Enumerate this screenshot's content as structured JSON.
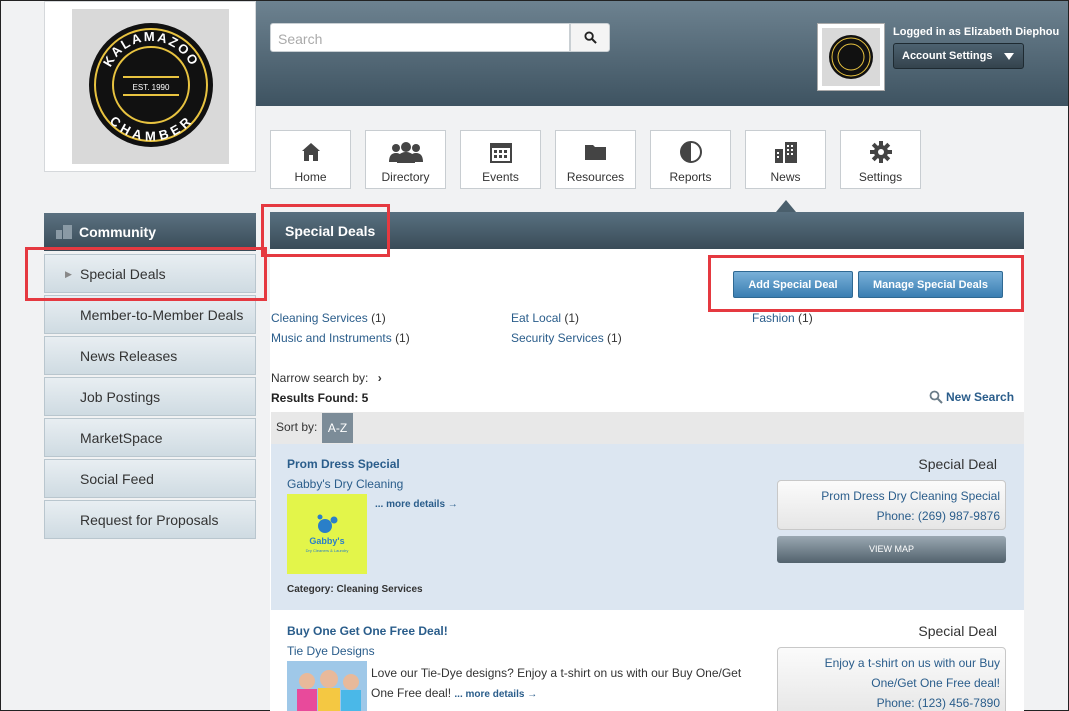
{
  "header": {
    "search_placeholder": "Search",
    "logged_in": "Logged in as Elizabeth Diephou",
    "account_settings": "Account Settings"
  },
  "nav": [
    {
      "label": "Home",
      "icon": "home-icon"
    },
    {
      "label": "Directory",
      "icon": "people-icon"
    },
    {
      "label": "Events",
      "icon": "calendar-icon"
    },
    {
      "label": "Resources",
      "icon": "folder-icon"
    },
    {
      "label": "Reports",
      "icon": "pie-chart-icon"
    },
    {
      "label": "News",
      "icon": "building-icon"
    },
    {
      "label": "Settings",
      "icon": "gear-icon"
    }
  ],
  "sidebar": {
    "title": "Community",
    "items": [
      {
        "label": "Special Deals"
      },
      {
        "label": "Member-to-Member Deals"
      },
      {
        "label": "News Releases"
      },
      {
        "label": "Job Postings"
      },
      {
        "label": "MarketSpace"
      },
      {
        "label": "Social Feed"
      },
      {
        "label": "Request for Proposals"
      }
    ]
  },
  "content": {
    "title": "Special Deals",
    "add_button": "Add Special Deal",
    "manage_button": "Manage Special Deals",
    "categories": [
      {
        "name": "Cleaning Services",
        "count": "(1)"
      },
      {
        "name": "Eat Local",
        "count": "(1)"
      },
      {
        "name": "Fashion",
        "count": "(1)"
      },
      {
        "name": "Music and Instruments",
        "count": "(1)"
      },
      {
        "name": "Security Services",
        "count": "(1)"
      }
    ],
    "narrow_label": "Narrow search by:",
    "results_label": "Results Found: 5",
    "new_search": "New Search",
    "sort_label": "Sort by:",
    "sort_az": "A-Z",
    "listings": [
      {
        "title": "Prom Dress Special",
        "business": "Gabby's Dry Cleaning",
        "type": "Special Deal",
        "more": "... more details →",
        "card_title": "Prom Dress Dry Cleaning Special",
        "phone": "Phone: (269) 987-9876",
        "view_map": "VIEW MAP",
        "category": "Category: Cleaning Services",
        "logo_name": "Gabby's",
        "logo_sub": "Dry Cleaners & Laundry"
      },
      {
        "title": "Buy One Get One Free Deal!",
        "business": "Tie Dye Designs",
        "type": "Special Deal",
        "desc": "Love our Tie-Dye designs? Enjoy a t-shirt on us with our Buy One/Get One Free deal!",
        "more": "... more details →",
        "card_title": "Enjoy a t-shirt on us with our Buy One/Get One Free deal!",
        "phone": "Phone: (123) 456-7890"
      }
    ]
  },
  "logo_text": {
    "top": "KALAMAZOO",
    "est": "EST. 1990",
    "bottom": "CHAMBER"
  },
  "colors": {
    "accent_blue": "#3a7eb2",
    "header_slate": "#3e5361",
    "highlight_red": "#e53940",
    "link": "#2a5d8b"
  }
}
